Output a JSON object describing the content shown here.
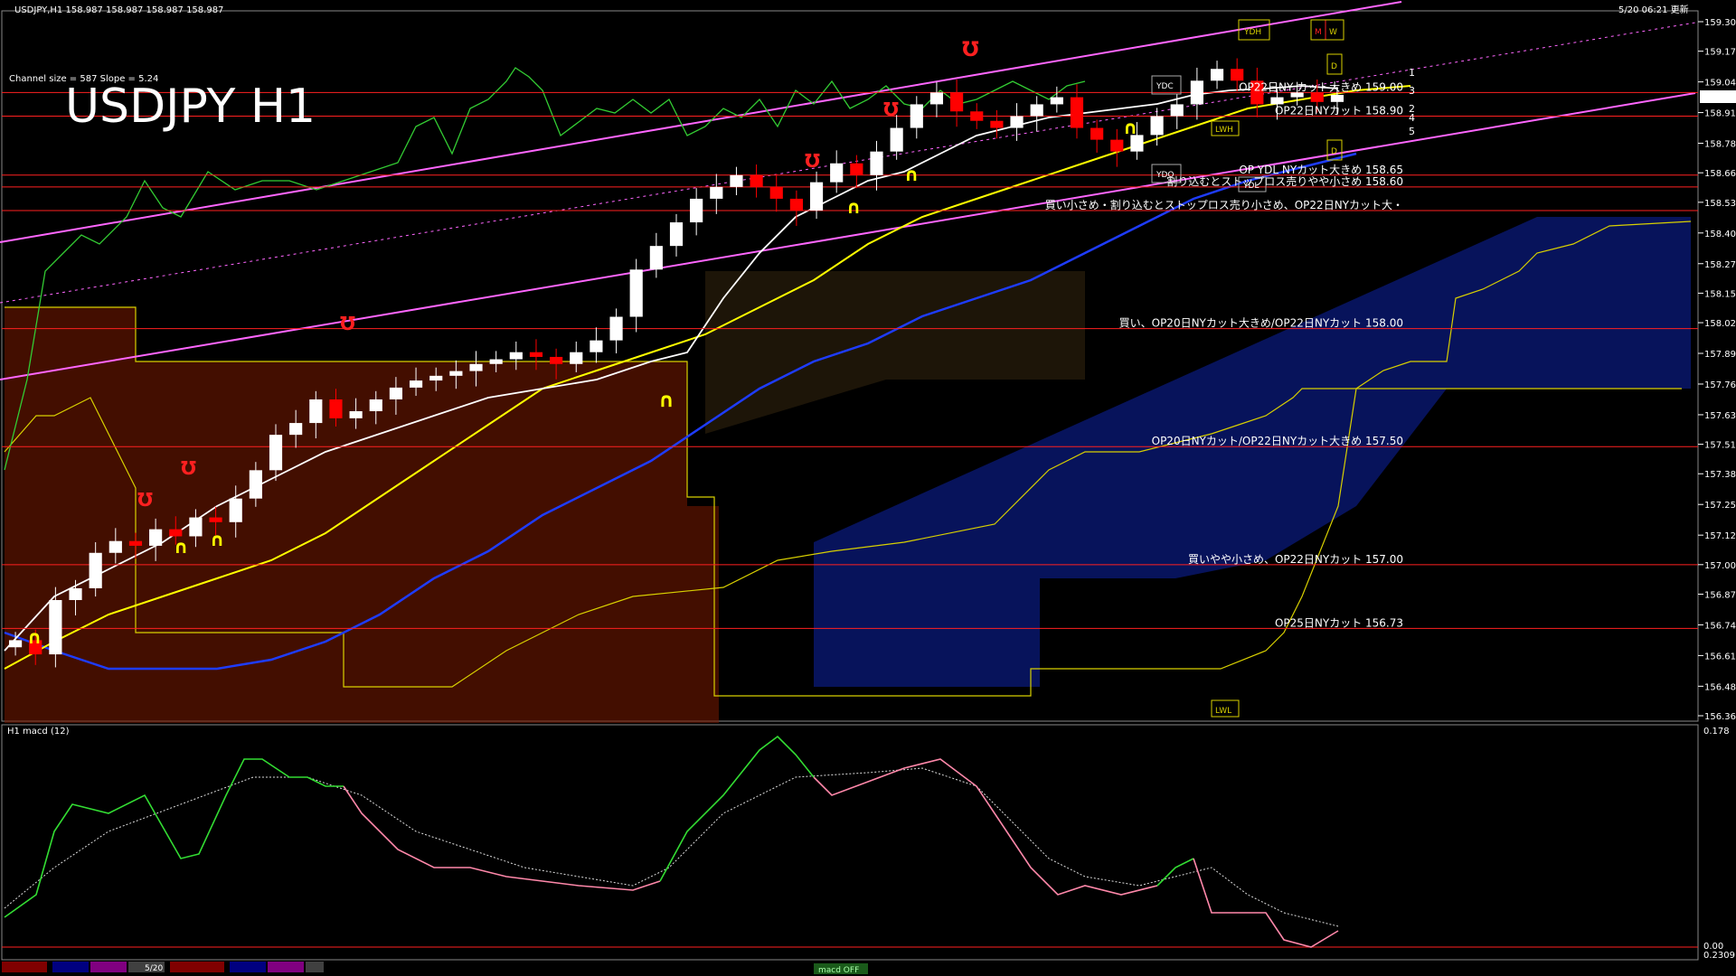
{
  "window": {
    "header": "USDJPY,H1  158.987 158.987 158.987 158.987",
    "datetime": "5/20 06:21 更新",
    "channel_info": "Channel size = 587 Slope = 5.24",
    "big_title": "USDJPY H1"
  },
  "colors": {
    "background": "#000000",
    "bull": "#ffffff",
    "bear": "#ff0000",
    "sma_fast": "#ffffff",
    "sma_mid": "#ffff00",
    "sma_slow": "#1e3cff",
    "channel": "#ff66ff",
    "chikou": "#33cc33",
    "level_line": "#ff2020",
    "macd_up": "#33dd33",
    "macd_down": "#ff88aa"
  },
  "price_axis": {
    "labels": [
      "159.300",
      "159.175",
      "159.045",
      "158.915",
      "158.785",
      "158.660",
      "158.535",
      "158.405",
      "158.275",
      "158.150",
      "158.025",
      "157.895",
      "157.765",
      "157.635",
      "157.510",
      "157.385",
      "157.255",
      "157.125",
      "157.000",
      "156.875",
      "156.745",
      "156.615",
      "156.485",
      "156.360"
    ],
    "current": "158.987"
  },
  "macd_axis": {
    "top": "0.178",
    "zero": "0.00",
    "bottom": "0.2309"
  },
  "macd_label": "H1  macd (12)",
  "level_labels": [
    {
      "price": 159.0,
      "text": "OP22日NY カット大きめ 159.00"
    },
    {
      "price": 158.9,
      "text": "OP22日NYカット 158.90"
    },
    {
      "price": 158.65,
      "text": "OP YDL NYカット大きめ 158.65"
    },
    {
      "price": 158.6,
      "text": "割り込むとストップロス売りやや小さめ 158.60"
    },
    {
      "price": 158.5,
      "text": "買い小さめ・割り込むとストップロス売り小さめ、OP22日NYカット大・"
    },
    {
      "price": 158.0,
      "text": "買い、OP20日NYカット大きめ/OP22日NYカット 158.00"
    },
    {
      "price": 157.5,
      "text": "OP20日NYカット/OP22日NYカット大きめ 157.50"
    },
    {
      "price": 157.0,
      "text": "買いやや小さめ、OP22日NYカット 157.00"
    },
    {
      "price": 156.73,
      "text": "OP25日NYカット 156.73"
    }
  ],
  "tags": {
    "ydh": "YDH",
    "m": "M",
    "w": "W",
    "d": "D",
    "ydc": "YDC",
    "ydo": "YDO",
    "ydl": "YDL",
    "lwh": "LWH",
    "lwl": "LWL",
    "n1": "1",
    "n3": "3",
    "n2": "2",
    "n4": "4",
    "n5": "5"
  },
  "bottom_bar": {
    "date": "5/20",
    "indicator": "macd OFF"
  },
  "chart_data": {
    "type": "candlestick",
    "title": "USDJPY H1",
    "symbol": "USDJPY",
    "timeframe": "H1",
    "ylim": [
      156.36,
      159.3
    ],
    "close_path": [
      156.68,
      156.62,
      156.85,
      156.9,
      157.05,
      157.1,
      157.08,
      157.15,
      157.12,
      157.2,
      157.18,
      157.28,
      157.4,
      157.55,
      157.6,
      157.7,
      157.62,
      157.65,
      157.7,
      157.75,
      157.78,
      157.8,
      157.82,
      157.85,
      157.87,
      157.9,
      157.88,
      157.85,
      157.9,
      157.95,
      158.05,
      158.25,
      158.35,
      158.45,
      158.55,
      158.6,
      158.65,
      158.6,
      158.55,
      158.5,
      158.62,
      158.7,
      158.65,
      158.75,
      158.85,
      158.95,
      159.0,
      158.92,
      158.88,
      158.85,
      158.9,
      158.95,
      158.98,
      158.85,
      158.8,
      158.75,
      158.82,
      158.9,
      158.95,
      159.05,
      159.1,
      159.05,
      158.95,
      158.98,
      159.0,
      158.96,
      158.99
    ],
    "levels": [
      159.0,
      158.9,
      158.65,
      158.6,
      158.5,
      158.0,
      157.5,
      157.0,
      156.73
    ]
  }
}
